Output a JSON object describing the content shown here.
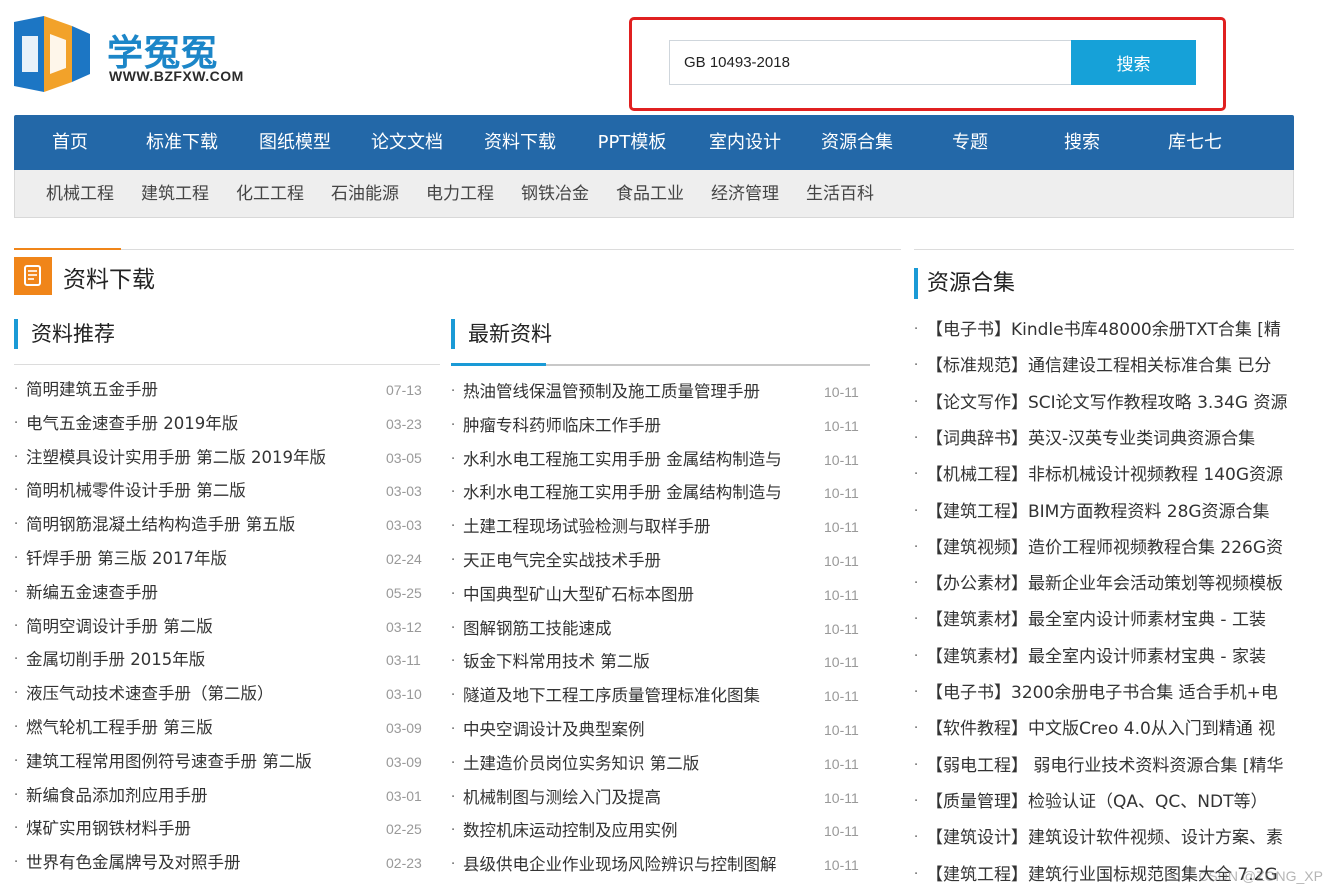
{
  "header": {
    "logo_text": "学冤冤",
    "logo_url": "WWW.BZFXW.COM",
    "search_value": "GB 10493-2018",
    "search_button": "搜索"
  },
  "nav": {
    "main": [
      "首页",
      "标准下载",
      "图纸模型",
      "论文文档",
      "资料下载",
      "PPT模板",
      "室内设计",
      "资源合集",
      "专题",
      "搜索",
      "库七七"
    ],
    "sub": [
      "机械工程",
      "建筑工程",
      "化工工程",
      "石油能源",
      "电力工程",
      "钢铁冶金",
      "食品工业",
      "经济管理",
      "生活百科"
    ]
  },
  "section": {
    "title": "资料下载",
    "recommend": {
      "heading": "资料推荐",
      "items": [
        {
          "title": "简明建筑五金手册",
          "date": "07-13"
        },
        {
          "title": "电气五金速查手册 2019年版",
          "date": "03-23"
        },
        {
          "title": "注塑模具设计实用手册 第二版 2019年版",
          "date": "03-05"
        },
        {
          "title": "简明机械零件设计手册 第二版",
          "date": "03-03"
        },
        {
          "title": "简明钢筋混凝土结构构造手册 第五版",
          "date": "03-03"
        },
        {
          "title": "钎焊手册 第三版 2017年版",
          "date": "02-24"
        },
        {
          "title": "新编五金速查手册",
          "date": "05-25"
        },
        {
          "title": "简明空调设计手册 第二版",
          "date": "03-12"
        },
        {
          "title": "金属切削手册 2015年版",
          "date": "03-11"
        },
        {
          "title": "液压气动技术速查手册（第二版）",
          "date": "03-10"
        },
        {
          "title": "燃气轮机工程手册 第三版",
          "date": "03-09"
        },
        {
          "title": "建筑工程常用图例符号速查手册 第二版",
          "date": "03-09"
        },
        {
          "title": "新编食品添加剂应用手册",
          "date": "03-01"
        },
        {
          "title": "煤矿实用钢铁材料手册",
          "date": "02-25"
        },
        {
          "title": "世界有色金属牌号及对照手册",
          "date": "02-23"
        }
      ]
    },
    "latest": {
      "heading": "最新资料",
      "items": [
        {
          "title": "热油管线保温管预制及施工质量管理手册",
          "date": "10-11"
        },
        {
          "title": "肿瘤专科药师临床工作手册",
          "date": "10-11"
        },
        {
          "title": "水利水电工程施工实用手册 金属结构制造与",
          "date": "10-11"
        },
        {
          "title": "水利水电工程施工实用手册 金属结构制造与",
          "date": "10-11"
        },
        {
          "title": "土建工程现场试验检测与取样手册",
          "date": "10-11"
        },
        {
          "title": "天正电气完全实战技术手册",
          "date": "10-11"
        },
        {
          "title": "中国典型矿山大型矿石标本图册",
          "date": "10-11"
        },
        {
          "title": "图解钢筋工技能速成",
          "date": "10-11"
        },
        {
          "title": "钣金下料常用技术 第二版",
          "date": "10-11"
        },
        {
          "title": "隧道及地下工程工序质量管理标准化图集",
          "date": "10-11"
        },
        {
          "title": "中央空调设计及典型案例",
          "date": "10-11"
        },
        {
          "title": "土建造价员岗位实务知识 第二版",
          "date": "10-11"
        },
        {
          "title": "机械制图与测绘入门及提高",
          "date": "10-11"
        },
        {
          "title": "数控机床运动控制及应用实例",
          "date": "10-11"
        },
        {
          "title": "县级供电企业作业现场风险辨识与控制图解",
          "date": "10-11"
        }
      ]
    }
  },
  "resources": {
    "heading": "资源合集",
    "items": [
      "【电子书】Kindle书库48000余册TXT合集 [精",
      "【标准规范】通信建设工程相关标准合集 已分",
      "【论文写作】SCI论文写作教程攻略 3.34G 资源",
      "【词典辞书】英汉-汉英专业类词典资源合集",
      "【机械工程】非标机械设计视频教程 140G资源",
      "【建筑工程】BIM方面教程资料 28G资源合集",
      "【建筑视频】造价工程师视频教程合集 226G资",
      "【办公素材】最新企业年会活动策划等视频模板",
      "【建筑素材】最全室内设计师素材宝典 - 工装",
      "【建筑素材】最全室内设计师素材宝典 - 家装",
      "【电子书】3200余册电子书合集 适合手机+电",
      "【软件教程】中文版Creo 4.0从入门到精通 视",
      "【弱电工程】 弱电行业技术资料资源合集 [精华",
      "【质量管理】检验认证（QA、QC、NDT等）",
      "【建筑设计】建筑设计软件视频、设计方案、素",
      "【建筑工程】建筑行业国标规范图集大全 7.2G"
    ]
  },
  "watermark": "CSDN @ZONG_XP",
  "colors": {
    "nav_blue": "#2368a8",
    "accent_orange": "#f08519",
    "accent_blue": "#1a9ad6",
    "search_red": "#e02020"
  }
}
